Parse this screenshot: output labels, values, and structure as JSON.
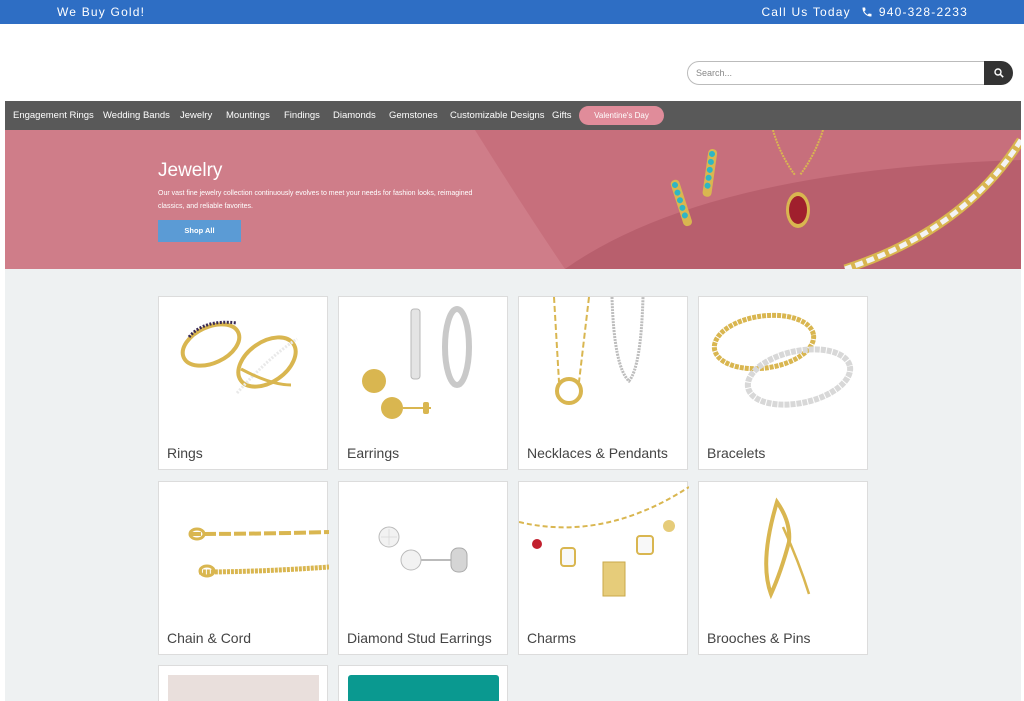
{
  "topbar": {
    "left_text": "We Buy Gold!",
    "call_text": "Call Us Today",
    "phone": "940-328-2233",
    "background": "#2e6ec4"
  },
  "search": {
    "placeholder": "Search..."
  },
  "nav": {
    "items": [
      "Engagement Rings",
      "Wedding Bands",
      "Jewelry",
      "Mountings",
      "Findings",
      "Diamonds",
      "Gemstones",
      "Customizable Designs",
      "Gifts"
    ],
    "highlight": "Valentine's Day"
  },
  "hero": {
    "title": "Jewelry",
    "description": "Our vast fine jewelry collection continuously  evolves to meet your needs for fashion looks, reimagined classics, and reliable favorites.",
    "button": "Shop All"
  },
  "categories": [
    {
      "label": "Rings",
      "icon": "rings-image"
    },
    {
      "label": "Earrings",
      "icon": "earrings-image"
    },
    {
      "label": "Necklaces & Pendants",
      "icon": "necklaces-image"
    },
    {
      "label": "Bracelets",
      "icon": "bracelets-image"
    },
    {
      "label": "Chain & Cord",
      "icon": "chain-image"
    },
    {
      "label": "Diamond Stud Earrings",
      "icon": "stud-earrings-image"
    },
    {
      "label": "Charms",
      "icon": "charms-image"
    },
    {
      "label": "Brooches & Pins",
      "icon": "brooch-image"
    }
  ]
}
